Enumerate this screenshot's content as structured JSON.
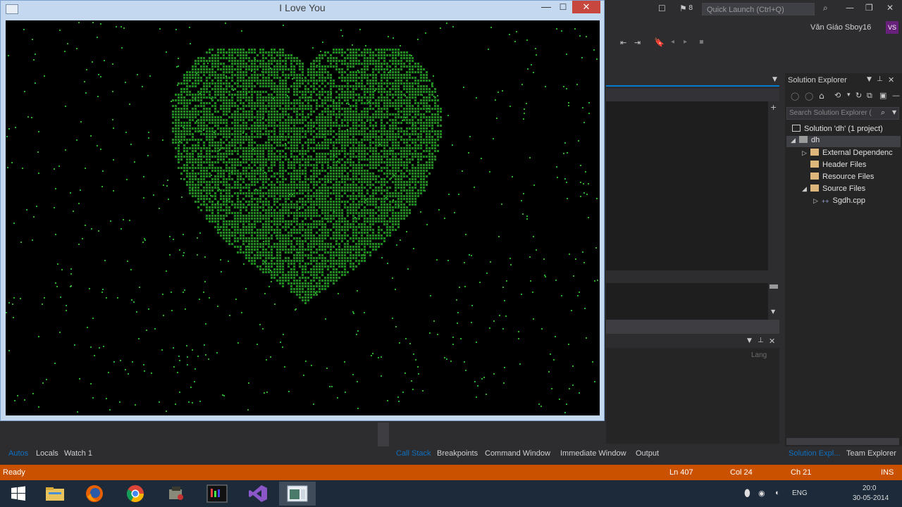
{
  "ide": {
    "quick_launch_placeholder": "Quick Launch (Ctrl+Q)",
    "notif_count": "8",
    "user_name": "Văn Giáo Sboy16",
    "user_initials": "VS",
    "language_label": "Lang",
    "solution_explorer": {
      "title": "Solution Explorer",
      "search_placeholder": "Search Solution Explorer (",
      "tree": [
        {
          "label": "Solution 'dh' (1 project)",
          "icon": "solution-icon"
        },
        {
          "label": "dh",
          "icon": "project-icon"
        },
        {
          "label": "External Dependenc",
          "icon": "folder-icon"
        },
        {
          "label": "Header Files",
          "icon": "folder-icon"
        },
        {
          "label": "Resource Files",
          "icon": "folder-icon"
        },
        {
          "label": "Source Files",
          "icon": "folder-icon"
        },
        {
          "label": "Sgdh.cpp",
          "icon": "cpp-file-icon"
        }
      ]
    },
    "bottom_left_tabs": [
      "Autos",
      "Locals",
      "Watch 1"
    ],
    "bottom_mid_tabs": [
      "Call Stack",
      "Breakpoints",
      "Command Window",
      "Immediate Window",
      "Output"
    ],
    "bottom_right_tabs": [
      "Solution Expl...",
      "Team Explorer"
    ],
    "status": {
      "ready": "Ready",
      "ln": "Ln 407",
      "col": "Col 24",
      "ch": "Ch 21",
      "ins": "INS"
    }
  },
  "window": {
    "title": "I Love You",
    "minimize": "—",
    "maximize": "☐",
    "close": "✕"
  },
  "canvas": {
    "background": "#000000",
    "heart_color": "#1f8a1f",
    "dot_color": "#2cae2c"
  },
  "taskbar": {
    "apps": [
      "windows-start-icon",
      "file-explorer-icon",
      "firefox-icon",
      "chrome-icon",
      "installer-icon",
      "terminal-icon",
      "visual-studio-icon",
      "console-app-icon"
    ],
    "tray": {
      "lang": "ENG",
      "time": "20:0",
      "date": "30-05-2014"
    }
  }
}
